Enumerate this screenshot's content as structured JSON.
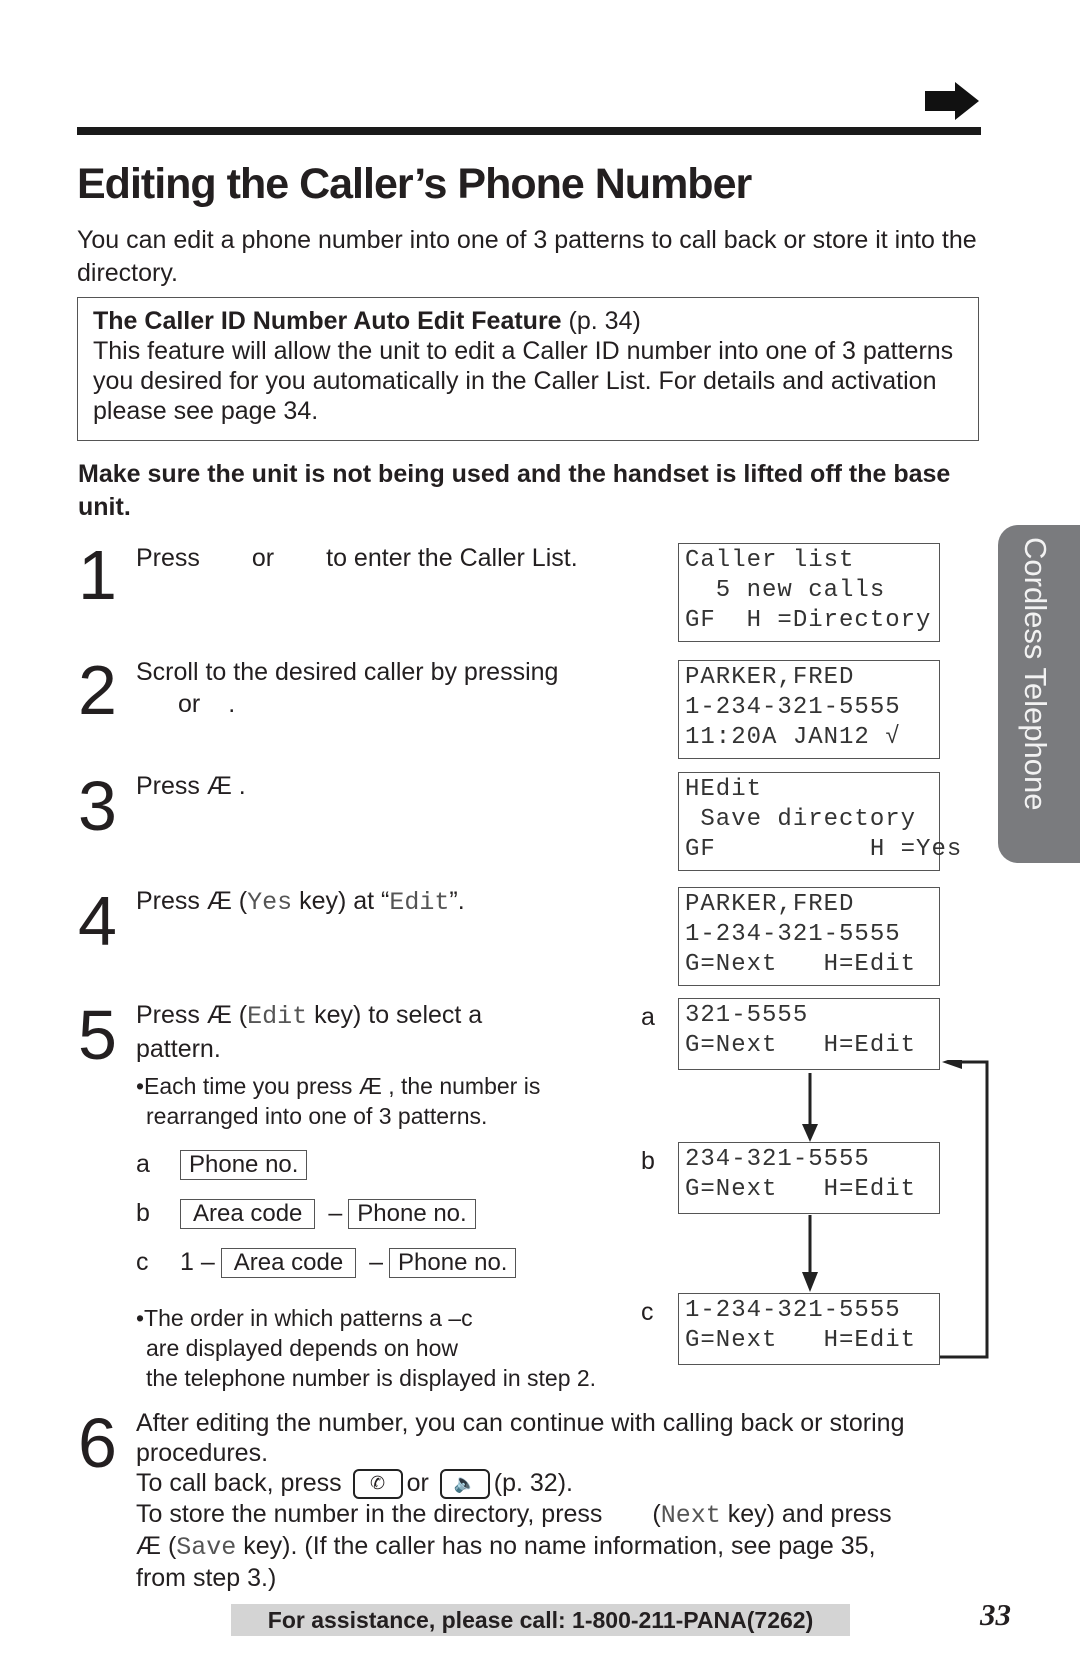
{
  "header": {
    "next_page_icon": "right-arrow-icon",
    "title": "Editing the Caller’s Phone Number",
    "intro": "You can edit a phone number into one of 3 patterns to call back or store it into the directory."
  },
  "feature_box": {
    "title": "The Caller ID Number Auto Edit Feature",
    "page_ref": " (p. 34)",
    "body": "This feature will allow the unit to edit a Caller ID number into one of 3 patterns you desired for you automatically in the Caller List. For details and activation please see page 34."
  },
  "note": "Make sure the unit is not being used and the handset is lifted off the base unit.",
  "steps": [
    {
      "num": "1",
      "text_a": "Press",
      "text_b": "or",
      "text_c": "to enter the Caller List."
    },
    {
      "num": "2",
      "line1": "Scroll to the desired caller by pressing",
      "text_or": "or",
      "text_dot": "."
    },
    {
      "num": "3",
      "text": "Press Æ ."
    },
    {
      "num": "4",
      "pre": "Press Æ  (",
      "key": "Yes",
      "mid": " key) at “",
      "key2": "Edit",
      "post": "”."
    },
    {
      "num": "5",
      "pre": "Press Æ  (",
      "key": "Edit",
      "post": " key) to select a",
      "line2": "pattern.",
      "bullet1_l1": "•Each time you press Æ , the number is",
      "bullet1_l2": "rearranged into one of 3 patterns.",
      "bullet2_l1": "•The order in which patterns a –c",
      "bullet2_l2": "are displayed depends on how",
      "bullet2_l3": "the telephone number is displayed in step 2."
    },
    {
      "num": "6",
      "line1": "After editing the number, you can continue with calling back or storing",
      "line2": "procedures.",
      "call_pre": "To call back, press",
      "call_or": "or",
      "call_post": "(p. 32).",
      "store_pre": "To store the number in the directory, press",
      "store_key": "Next",
      "store_post": " key) and press",
      "save_pre": "Æ  (",
      "save_key": "Save",
      "save_post": " key). (If the caller has no name information, see page 35,",
      "line_last": "from step 3.)"
    }
  ],
  "patterns": [
    {
      "label": "a",
      "parts": [
        "Phone no."
      ]
    },
    {
      "label": "b",
      "parts": [
        "Area code",
        "–",
        "Phone no."
      ]
    },
    {
      "label": "c",
      "prefix": "1 –",
      "parts": [
        "Area code",
        "–",
        "Phone no."
      ]
    }
  ],
  "lcd_screens": [
    {
      "lines": [
        "Caller list",
        "  5 new calls",
        "GF  H =Directory"
      ]
    },
    {
      "lines": [
        "PARKER,FRED",
        "1-234-321-5555",
        "11:20A JAN12 √"
      ]
    },
    {
      "lines": [
        "HEdit",
        " Save directory",
        "GF          H =Yes"
      ]
    },
    {
      "lines": [
        "PARKER,FRED",
        "1-234-321-5555",
        "G=Next   H=Edit"
      ]
    },
    {
      "label": "a",
      "lines": [
        "321-5555",
        "G=Next   H=Edit"
      ]
    },
    {
      "label": "b",
      "lines": [
        "234-321-5555",
        "G=Next   H=Edit"
      ]
    },
    {
      "label": "c",
      "lines": [
        "1-234-321-5555",
        "G=Next   H=Edit"
      ]
    }
  ],
  "side_tab": "Cordless Telephone",
  "footer": {
    "assistance": "For assistance, please call: 1-800-211-PANA(7262)",
    "page_number": "33"
  }
}
